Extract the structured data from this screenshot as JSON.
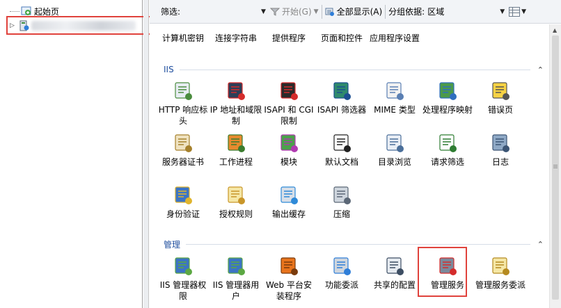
{
  "tree": {
    "start_page": "起始页"
  },
  "toolbar": {
    "filter_label": "筛选:",
    "filter_value": "",
    "start_label": "开始(G)",
    "show_all_label": "全部显示(A)",
    "group_by_label": "分组依据:",
    "group_by_value": "区域"
  },
  "top_row": [
    {
      "label": "计算机密钥",
      "icon": "machine-key-icon"
    },
    {
      "label": "连接字符串",
      "icon": "connection-strings-icon"
    },
    {
      "label": "提供程序",
      "icon": "providers-icon"
    },
    {
      "label": "页面和控件",
      "icon": "pages-controls-icon"
    },
    {
      "label": "应用程序设置",
      "icon": "app-settings-icon"
    }
  ],
  "iis": {
    "title": "IIS",
    "items": [
      {
        "label": "HTTP 响应标头",
        "icon": "http-response-headers-icon"
      },
      {
        "label": "IP 地址和域限制",
        "icon": "ip-domain-restrictions-icon"
      },
      {
        "label": "ISAPI 和 CGI 限制",
        "icon": "isapi-cgi-restrictions-icon"
      },
      {
        "label": "ISAPI 筛选器",
        "icon": "isapi-filters-icon"
      },
      {
        "label": "MIME 类型",
        "icon": "mime-types-icon"
      },
      {
        "label": "处理程序映射",
        "icon": "handler-mappings-icon"
      },
      {
        "label": "错误页",
        "icon": "error-pages-icon"
      },
      {
        "label": "服务器证书",
        "icon": "server-certificates-icon"
      },
      {
        "label": "工作进程",
        "icon": "worker-processes-icon"
      },
      {
        "label": "模块",
        "icon": "modules-icon"
      },
      {
        "label": "默认文档",
        "icon": "default-document-icon"
      },
      {
        "label": "目录浏览",
        "icon": "directory-browsing-icon"
      },
      {
        "label": "请求筛选",
        "icon": "request-filtering-icon"
      },
      {
        "label": "日志",
        "icon": "logging-icon"
      },
      {
        "label": "身份验证",
        "icon": "authentication-icon"
      },
      {
        "label": "授权规则",
        "icon": "authorization-rules-icon"
      },
      {
        "label": "输出缓存",
        "icon": "output-caching-icon"
      },
      {
        "label": "压缩",
        "icon": "compression-icon"
      }
    ]
  },
  "management": {
    "title": "管理",
    "items": [
      {
        "label": "IIS 管理器权限",
        "icon": "iis-manager-permissions-icon"
      },
      {
        "label": "IIS 管理器用户",
        "icon": "iis-manager-users-icon"
      },
      {
        "label": "Web 平台安装程序",
        "icon": "web-platform-installer-icon"
      },
      {
        "label": "功能委派",
        "icon": "feature-delegation-icon"
      },
      {
        "label": "共享的配置",
        "icon": "shared-configuration-icon"
      },
      {
        "label": "管理服务",
        "icon": "management-service-icon"
      },
      {
        "label": "管理服务委派",
        "icon": "management-service-delegation-icon"
      }
    ]
  },
  "colors": {
    "highlight": "#e0423c",
    "group_title": "#1f4e9e"
  }
}
